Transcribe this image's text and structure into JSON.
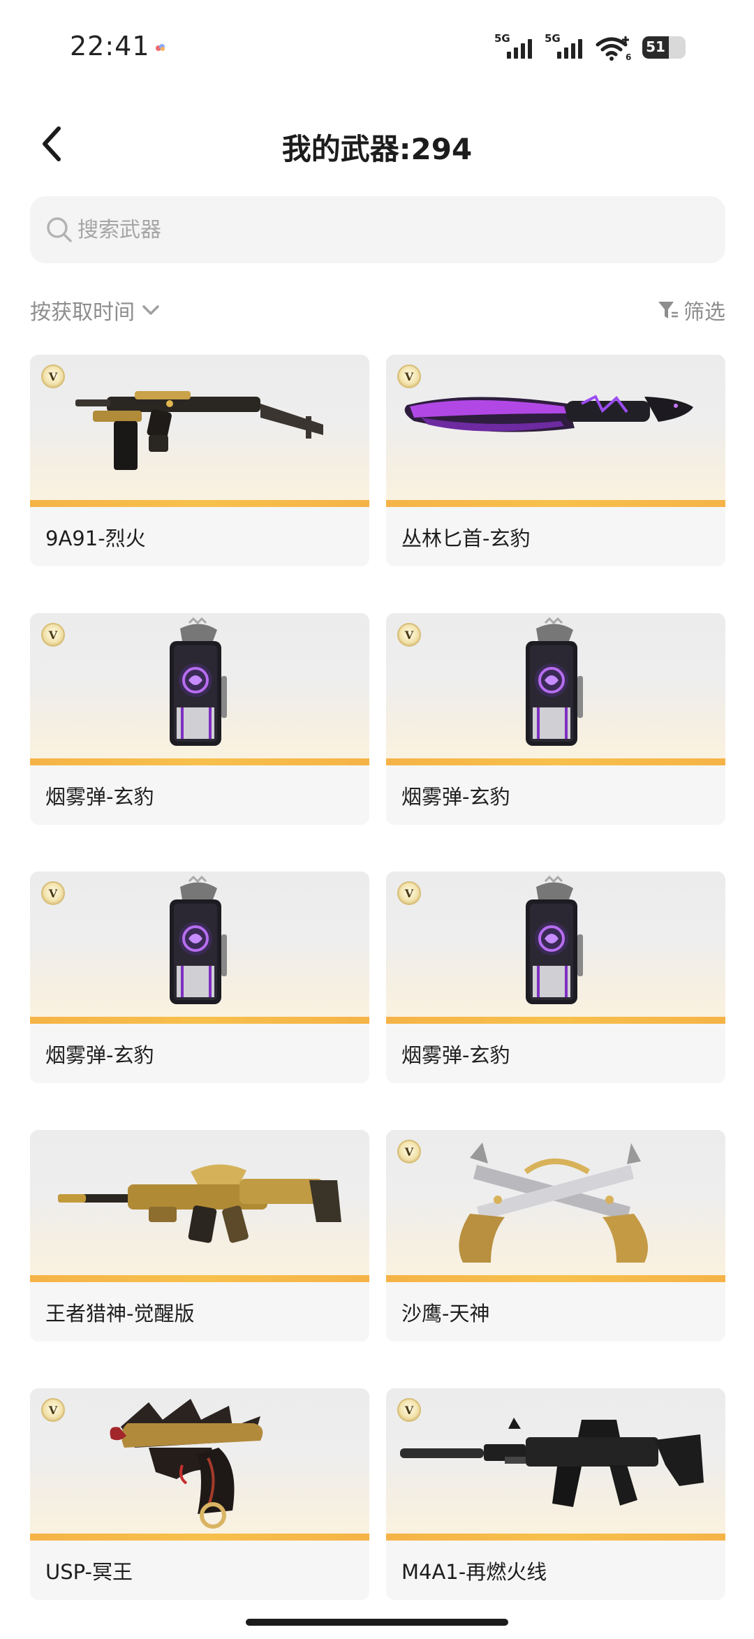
{
  "status_bar": {
    "time": "22:41",
    "network_1": "5G",
    "network_2": "5G",
    "wifi_sub": "6",
    "battery": "51",
    "battery_level": 0.51
  },
  "header": {
    "title": "我的武器:294",
    "back_icon": "chevron-left-icon"
  },
  "search": {
    "placeholder": "搜索武器",
    "value": "",
    "icon": "search-icon"
  },
  "toolbar": {
    "sort_label": "按获取时间",
    "sort_icon": "chevron-down-icon",
    "filter_label": "筛选",
    "filter_icon": "funnel-icon"
  },
  "weapons": [
    {
      "name": "9A91-烈火",
      "badge": "V",
      "kind": "smg-gold"
    },
    {
      "name": "丛林匕首-玄豹",
      "badge": "V",
      "kind": "knife-purple"
    },
    {
      "name": "烟雾弹-玄豹",
      "badge": "V",
      "kind": "grenade"
    },
    {
      "name": "烟雾弹-玄豹",
      "badge": "V",
      "kind": "grenade"
    },
    {
      "name": "烟雾弹-玄豹",
      "badge": "V",
      "kind": "grenade"
    },
    {
      "name": "烟雾弹-玄豹",
      "badge": "V",
      "kind": "grenade"
    },
    {
      "name": "王者猎神-觉醒版",
      "badge": "",
      "kind": "rifle-gold"
    },
    {
      "name": "沙鹰-天神",
      "badge": "V",
      "kind": "dual-pistol"
    },
    {
      "name": "USP-冥王",
      "badge": "V",
      "kind": "pistol-dragon"
    },
    {
      "name": "M4A1-再燃火线",
      "badge": "V",
      "kind": "rifle-black"
    }
  ],
  "colors": {
    "accent_strip": "#f5b347",
    "card_bg": "#f6f6f6",
    "search_bg": "#f4f4f4"
  }
}
